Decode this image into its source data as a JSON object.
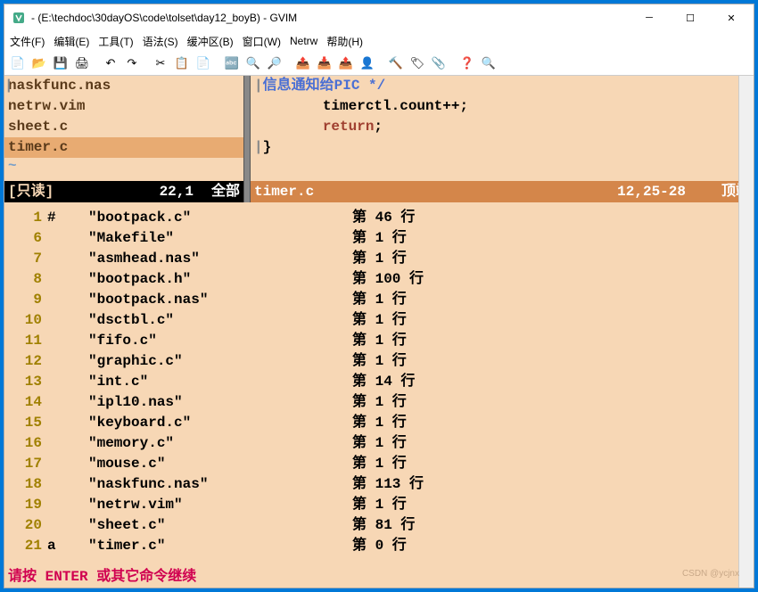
{
  "window": {
    "title": " - (E:\\techdoc\\30dayOS\\code\\tolset\\day12_boyB) - GVIM",
    "min": "─",
    "max": "☐",
    "close": "✕"
  },
  "menu": [
    "文件(F)",
    "编辑(E)",
    "工具(T)",
    "语法(S)",
    "缓冲区(B)",
    "窗口(W)",
    "Netrw",
    "帮助(H)"
  ],
  "toolbar": [
    "📄",
    "📂",
    "💾",
    "🖨",
    "",
    "↶",
    "↷",
    "",
    "✂",
    "📋",
    "📄",
    "",
    "🔤",
    "🔍",
    "🔎",
    "",
    "📤",
    "📥",
    "📤",
    "👤",
    "",
    "🔨",
    "🏷",
    "📎",
    "",
    "❓",
    "🔍"
  ],
  "left_pane": {
    "files": [
      "naskfunc.nas",
      "netrw.vim",
      "sheet.c",
      "timer.c"
    ],
    "selected_index": 3,
    "tilde": "~"
  },
  "right_pane": {
    "caret": "|",
    "lines": [
      {
        "pre": "",
        "comment": "信息通知给PIC */"
      },
      {
        "pre": "        ",
        "text": "timerctl.count++;"
      },
      {
        "pre": "        ",
        "keyword": "return",
        "text": ";"
      },
      {
        "pre": "",
        "text": "}"
      }
    ]
  },
  "status": {
    "left_label": "[只读]",
    "left_pos": "22,1",
    "left_all": "全部",
    "right_file": "timer.c",
    "right_pos": "12,25-28",
    "right_top": "顶端"
  },
  "buffers": [
    {
      "n": "1",
      "flag": "#",
      "name": "\"bootpack.c\"",
      "line": "第 46 行"
    },
    {
      "n": "6",
      "flag": "",
      "name": "\"Makefile\"",
      "line": "第 1 行"
    },
    {
      "n": "7",
      "flag": "",
      "name": "\"asmhead.nas\"",
      "line": "第 1 行"
    },
    {
      "n": "8",
      "flag": "",
      "name": "\"bootpack.h\"",
      "line": "第 100 行"
    },
    {
      "n": "9",
      "flag": "",
      "name": "\"bootpack.nas\"",
      "line": "第 1 行"
    },
    {
      "n": "10",
      "flag": "",
      "name": "\"dsctbl.c\"",
      "line": "第 1 行"
    },
    {
      "n": "11",
      "flag": "",
      "name": "\"fifo.c\"",
      "line": "第 1 行"
    },
    {
      "n": "12",
      "flag": "",
      "name": "\"graphic.c\"",
      "line": "第 1 行"
    },
    {
      "n": "13",
      "flag": "",
      "name": "\"int.c\"",
      "line": "第 14 行"
    },
    {
      "n": "14",
      "flag": "",
      "name": "\"ipl10.nas\"",
      "line": "第 1 行"
    },
    {
      "n": "15",
      "flag": "",
      "name": "\"keyboard.c\"",
      "line": "第 1 行"
    },
    {
      "n": "16",
      "flag": "",
      "name": "\"memory.c\"",
      "line": "第 1 行"
    },
    {
      "n": "17",
      "flag": "",
      "name": "\"mouse.c\"",
      "line": "第 1 行"
    },
    {
      "n": "18",
      "flag": "",
      "name": "\"naskfunc.nas\"",
      "line": "第 113 行"
    },
    {
      "n": "19",
      "flag": "",
      "name": "\"netrw.vim\"",
      "line": "第 1 行"
    },
    {
      "n": "20",
      "flag": "",
      "name": "\"sheet.c\"",
      "line": "第 81 行"
    },
    {
      "n": "21",
      "flag": "a",
      "name": "\"timer.c\"",
      "line": "第 0 行"
    }
  ],
  "prompt": "请按 ENTER 或其它命令继续",
  "watermark": "CSDN @ycjnx"
}
